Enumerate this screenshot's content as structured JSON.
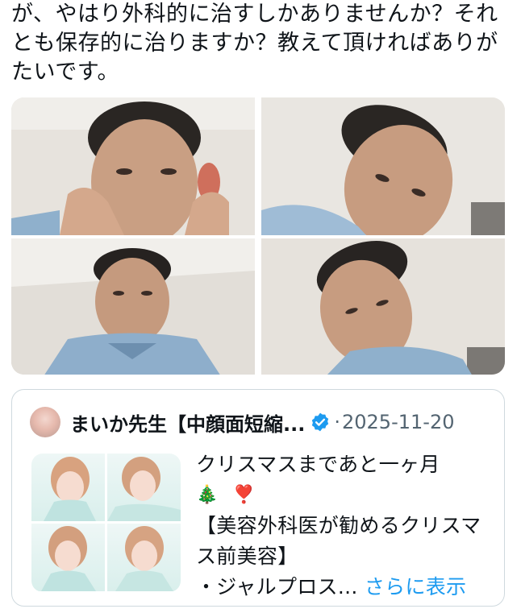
{
  "post": {
    "text": "が、やはり外科的に治すしかありませんか？それとも保存的に治りますか？教えて頂ければありがたいです。"
  },
  "media": {
    "photos": [
      {
        "pose": "hands-on-cheeks"
      },
      {
        "pose": "head-tilted-right"
      },
      {
        "pose": "looking-up"
      },
      {
        "pose": "head-tilted-left"
      }
    ]
  },
  "quote": {
    "author_name": "まいか先生【中顔面短縮...",
    "verified_icon": "verified-badge-icon",
    "separator": "·",
    "date": "2025-11-20",
    "line1": "クリスマスまであと一ヶ月",
    "emoji1": "🎄",
    "emoji2": "❣️",
    "line3": "【美容外科医が勧めるクリスマ",
    "line4": "ス前美容】",
    "line5": "・ジャルプロス...",
    "show_more": "さらに表示"
  },
  "colors": {
    "text": "#0f1419",
    "muted": "#536471",
    "link": "#1d9bf0",
    "border": "#cfd9de"
  }
}
